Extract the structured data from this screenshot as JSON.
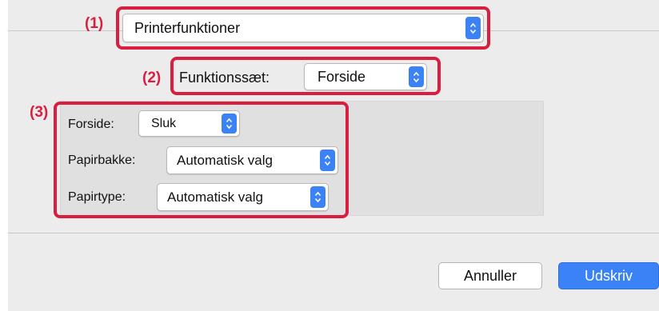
{
  "callouts": {
    "one": "(1)",
    "two": "(2)",
    "three": "(3)"
  },
  "panel_menu": {
    "selected": "Printerfunktioner"
  },
  "feature_set": {
    "label": "Funktionssæt:",
    "selected": "Forside"
  },
  "cover": {
    "label": "Forside:",
    "selected": "Sluk"
  },
  "paper_tray": {
    "label": "Papirbakke:",
    "selected": "Automatisk valg"
  },
  "paper_type": {
    "label": "Papirtype:",
    "selected": "Automatisk valg"
  },
  "buttons": {
    "cancel": "Annuller",
    "print": "Udskriv"
  },
  "colors": {
    "highlight": "#d81f3f",
    "accent": "#3b82f6",
    "dialog_background": "#ececec"
  },
  "icons": {
    "stepper": "up-down-chevrons-icon"
  }
}
